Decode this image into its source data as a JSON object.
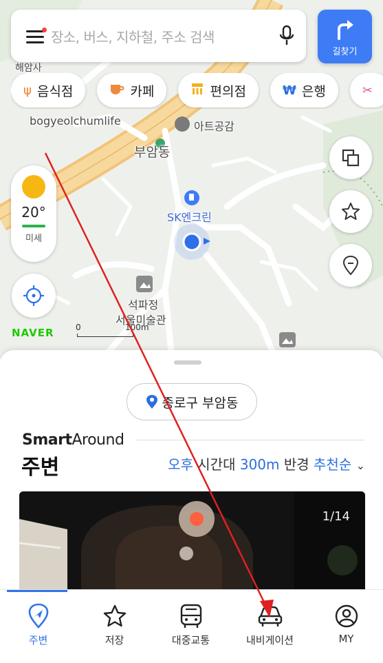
{
  "search": {
    "placeholder": "장소, 버스, 지하철, 주소 검색"
  },
  "route_button": {
    "label": "길찾기"
  },
  "chips": [
    {
      "icon": "fork-knife-icon",
      "label": "음식점"
    },
    {
      "icon": "coffee-cup-icon",
      "label": "카페"
    },
    {
      "icon": "store-icon",
      "label": "편의점"
    },
    {
      "icon": "won-icon",
      "label": "은행"
    }
  ],
  "map_labels": {
    "temple": "해암사",
    "place_en": "bogyeolchumlife",
    "art": "아트공감",
    "dong": "부암동",
    "gas": "SK엔크린",
    "museum_line1": "석파정",
    "museum_line2": "서울미술관"
  },
  "weather": {
    "temp": "20°",
    "air": "미세"
  },
  "brand": {
    "logo": "NAVER"
  },
  "scale": {
    "zero": "0",
    "unit": "100m"
  },
  "sheet": {
    "location": "종로구 부암동",
    "smart_bold": "Smart",
    "smart_regular": "Around",
    "title": "주변",
    "filter_time": "오후",
    "filter_time_suffix": "시간대",
    "filter_radius": "300m",
    "filter_radius_suffix": "반경",
    "filter_sort": "추천순",
    "photo_counter": "1/14"
  },
  "nav": [
    {
      "label": "주변",
      "icon": "location-pin-icon"
    },
    {
      "label": "저장",
      "icon": "star-icon"
    },
    {
      "label": "대중교통",
      "icon": "bus-icon"
    },
    {
      "label": "내비게이션",
      "icon": "car-icon"
    },
    {
      "label": "MY",
      "icon": "person-icon"
    }
  ],
  "colors": {
    "accent": "#3d7cf5",
    "nav_active": "#2f74e5",
    "highlight": "#2b6fe0",
    "naver_green": "#1ec800",
    "annotation": "#e02020"
  }
}
